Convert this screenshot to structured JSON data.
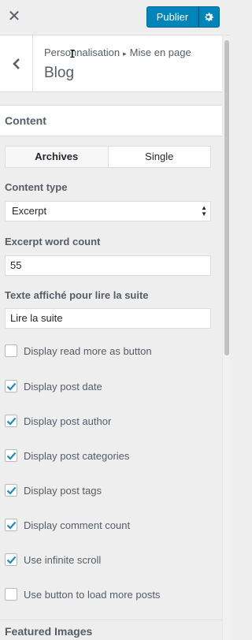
{
  "topbar": {
    "close_icon": "close-icon",
    "publish_label": "Publier",
    "settings_icon": "gear-icon"
  },
  "header": {
    "back_icon": "chevron-left-icon",
    "breadcrumb_parent": "Personnalisation",
    "breadcrumb_separator": "▸",
    "breadcrumb_current": "Mise en page",
    "title": "Blog"
  },
  "section": {
    "title": "Content",
    "tabs": [
      {
        "label": "Archives",
        "active": true
      },
      {
        "label": "Single",
        "active": false
      }
    ],
    "content_type": {
      "label": "Content type",
      "value": "Excerpt"
    },
    "excerpt_count": {
      "label": "Excerpt word count",
      "value": "55"
    },
    "read_more_text": {
      "label": "Texte affiché pour lire la suite",
      "value": "Lire la suite"
    },
    "checkboxes": [
      {
        "label": "Display read more as button",
        "checked": false
      },
      {
        "label": "Display post date",
        "checked": true
      },
      {
        "label": "Display post author",
        "checked": true
      },
      {
        "label": "Display post categories",
        "checked": true
      },
      {
        "label": "Display post tags",
        "checked": true
      },
      {
        "label": "Display comment count",
        "checked": true
      },
      {
        "label": "Use infinite scroll",
        "checked": true
      },
      {
        "label": "Use button to load more posts",
        "checked": false
      }
    ]
  },
  "next_section": {
    "title": "Featured Images"
  },
  "colors": {
    "accent": "#0085ba",
    "check": "#1e8cbe"
  }
}
